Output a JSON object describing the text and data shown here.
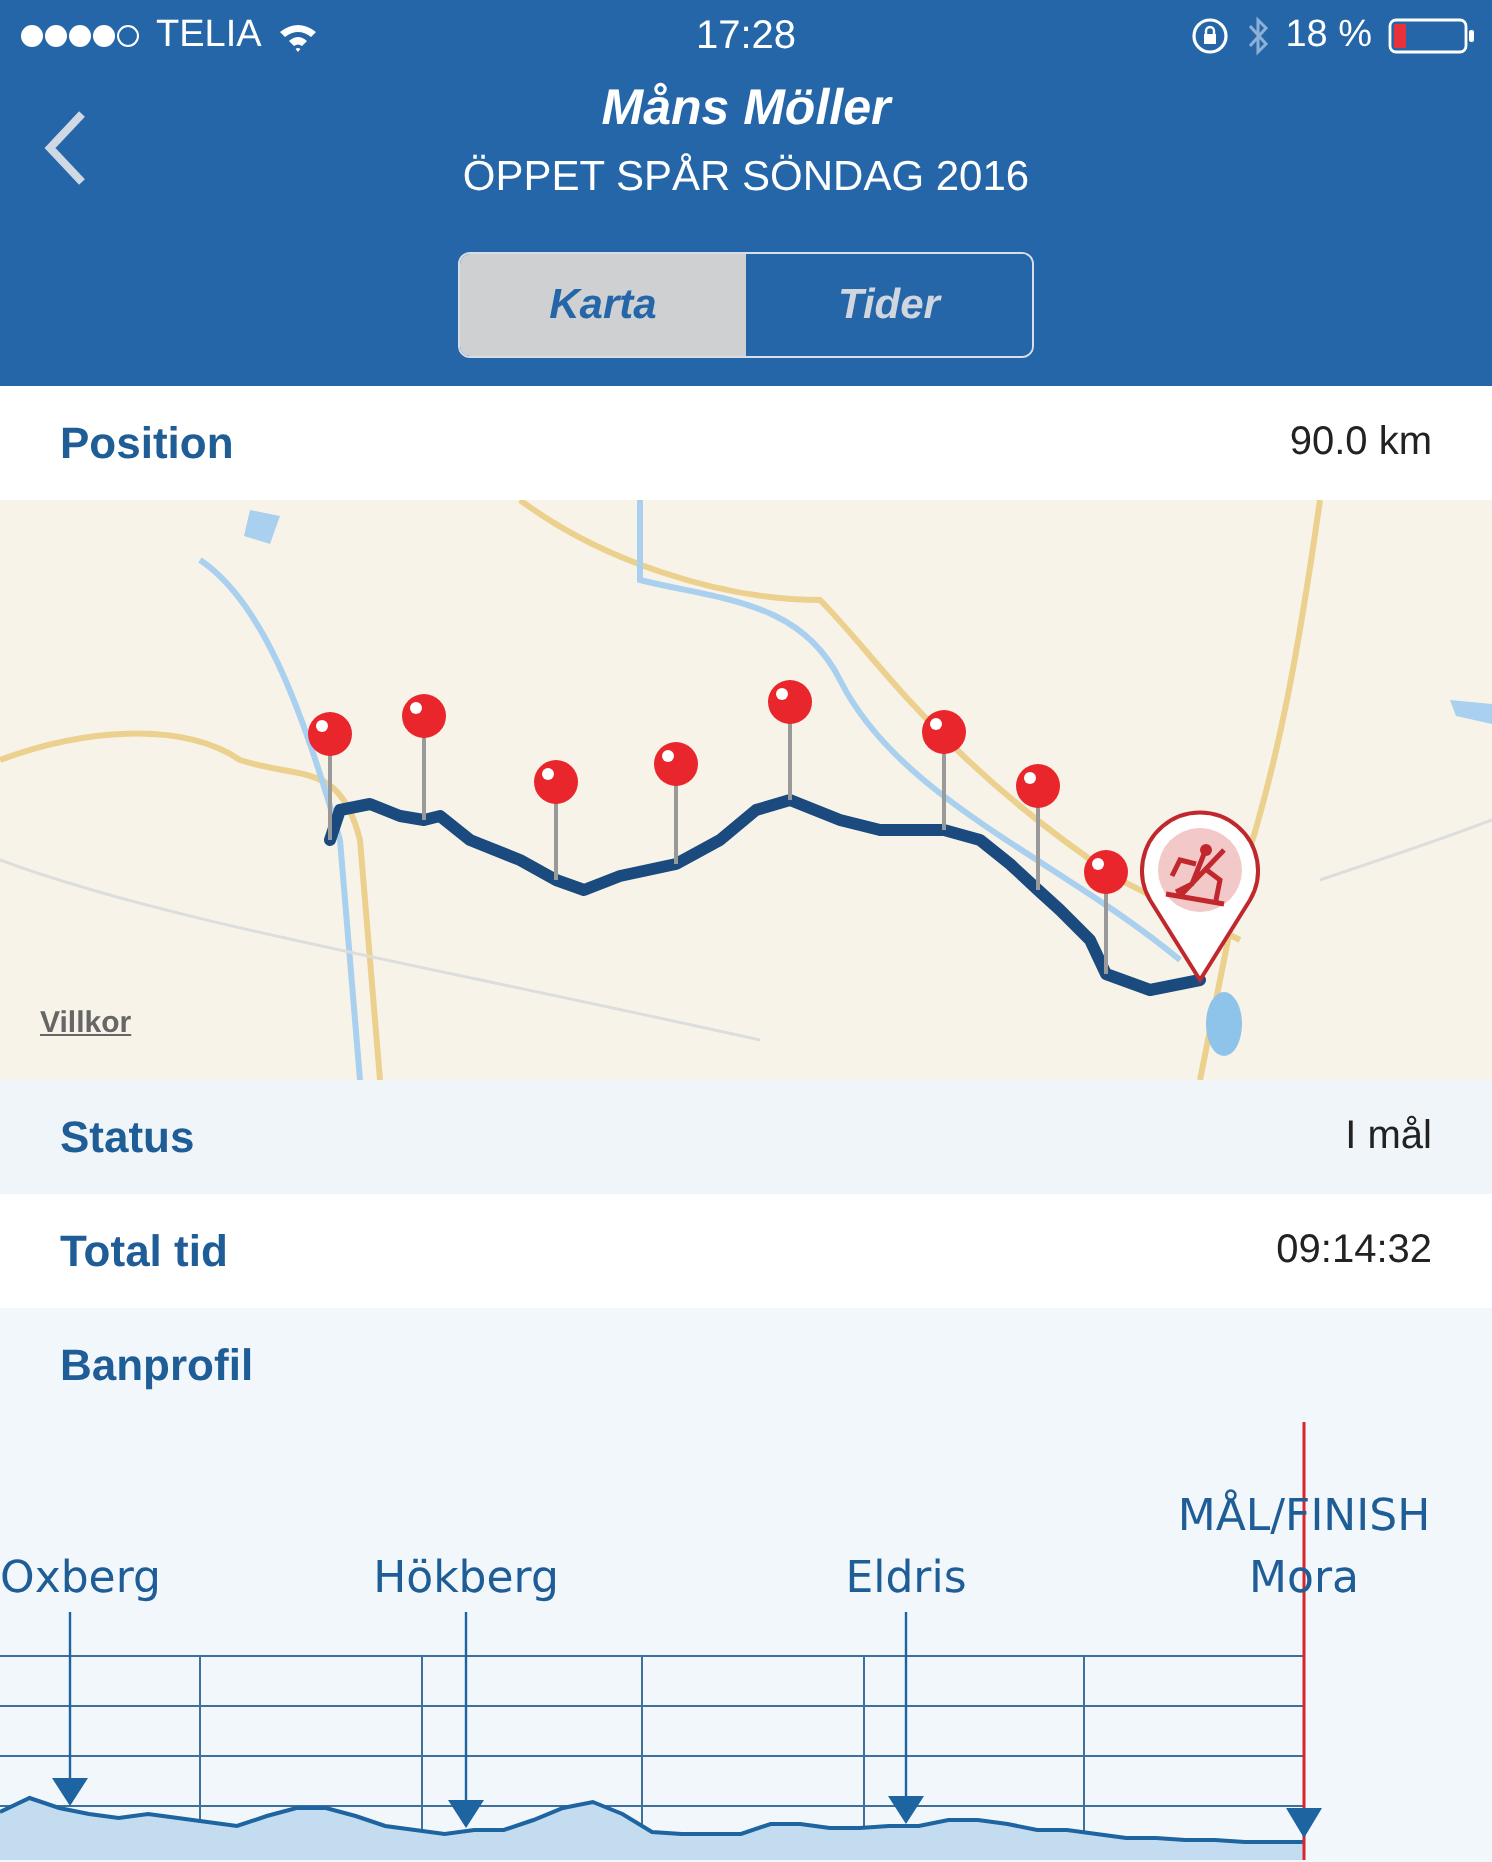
{
  "status_bar": {
    "carrier": "TELIA",
    "time": "17:28",
    "battery": "18 %"
  },
  "header": {
    "title": "Måns Möller",
    "subtitle": "ÖPPET SPÅR SÖNDAG 2016"
  },
  "tabs": [
    {
      "label": "Karta",
      "selected": true
    },
    {
      "label": "Tider",
      "selected": false
    }
  ],
  "position": {
    "label": "Position",
    "value": "90.0 km"
  },
  "map": {
    "terms_link": "Villkor"
  },
  "rows": [
    {
      "label": "Status",
      "value": "I mål"
    },
    {
      "label": "Total tid",
      "value": "09:14:32"
    }
  ],
  "profile": {
    "title": "Banprofil",
    "checkpoints": [
      {
        "kind": "checkpoint",
        "name": "Oxberg"
      },
      {
        "kind": "checkpoint",
        "name": "Hökberg"
      },
      {
        "kind": "checkpoint",
        "name": "Eldris"
      },
      {
        "kind": "finish",
        "name": "Mora",
        "caption": "MÅL/FINISH"
      }
    ]
  }
}
